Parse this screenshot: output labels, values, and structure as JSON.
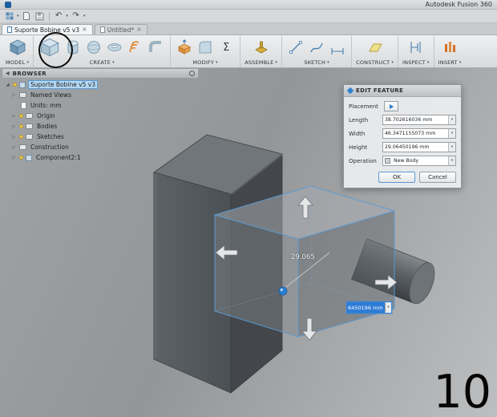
{
  "titlebar": {
    "app_title": "Autodesk Fusion 360"
  },
  "icons": {
    "caret": "▾",
    "close": "×",
    "sigma": "Σ",
    "undo": "↶",
    "redo": "↷",
    "collapse": "◀",
    "expand_open": "◢",
    "expand_closed": "▷"
  },
  "tabs": {
    "tab1": "Suporte Bobine v5 v3",
    "tab2": "Untitled*"
  },
  "ribbon": {
    "groups": [
      {
        "label": "MODEL"
      },
      {
        "label": "CREATE"
      },
      {
        "label": "MODIFY"
      },
      {
        "label": "ASSEMBLE"
      },
      {
        "label": "SKETCH"
      },
      {
        "label": "CONSTRUCT"
      },
      {
        "label": "INSPECT"
      },
      {
        "label": "INSERT"
      }
    ]
  },
  "browser": {
    "title": "BROWSER",
    "items": [
      {
        "label": "Suporte Bobine v5 v3"
      },
      {
        "label": "Named Views"
      },
      {
        "label": "Units: mm"
      },
      {
        "label": "Origin"
      },
      {
        "label": "Bodies"
      },
      {
        "label": "Sketches"
      },
      {
        "label": "Construction"
      },
      {
        "label": "Component2:1"
      }
    ]
  },
  "dialog": {
    "title": "EDIT FEATURE",
    "placement_label": "Placement",
    "length_label": "Length",
    "length_value": "38.702616036 mm",
    "width_label": "Width",
    "width_value": "46.3471155073 mm",
    "height_label": "Height",
    "height_value": "29.06450196 mm",
    "operation_label": "Operation",
    "operation_value": "New Body",
    "ok": "OK",
    "cancel": "Cancel"
  },
  "viewport": {
    "dimension_label": "29.065",
    "dimension_input_value": "6450196 mm",
    "step_number": "10"
  },
  "colors": {
    "selection_blue": "#5b9bd5",
    "highlight_blue": "#b3d7f2"
  }
}
